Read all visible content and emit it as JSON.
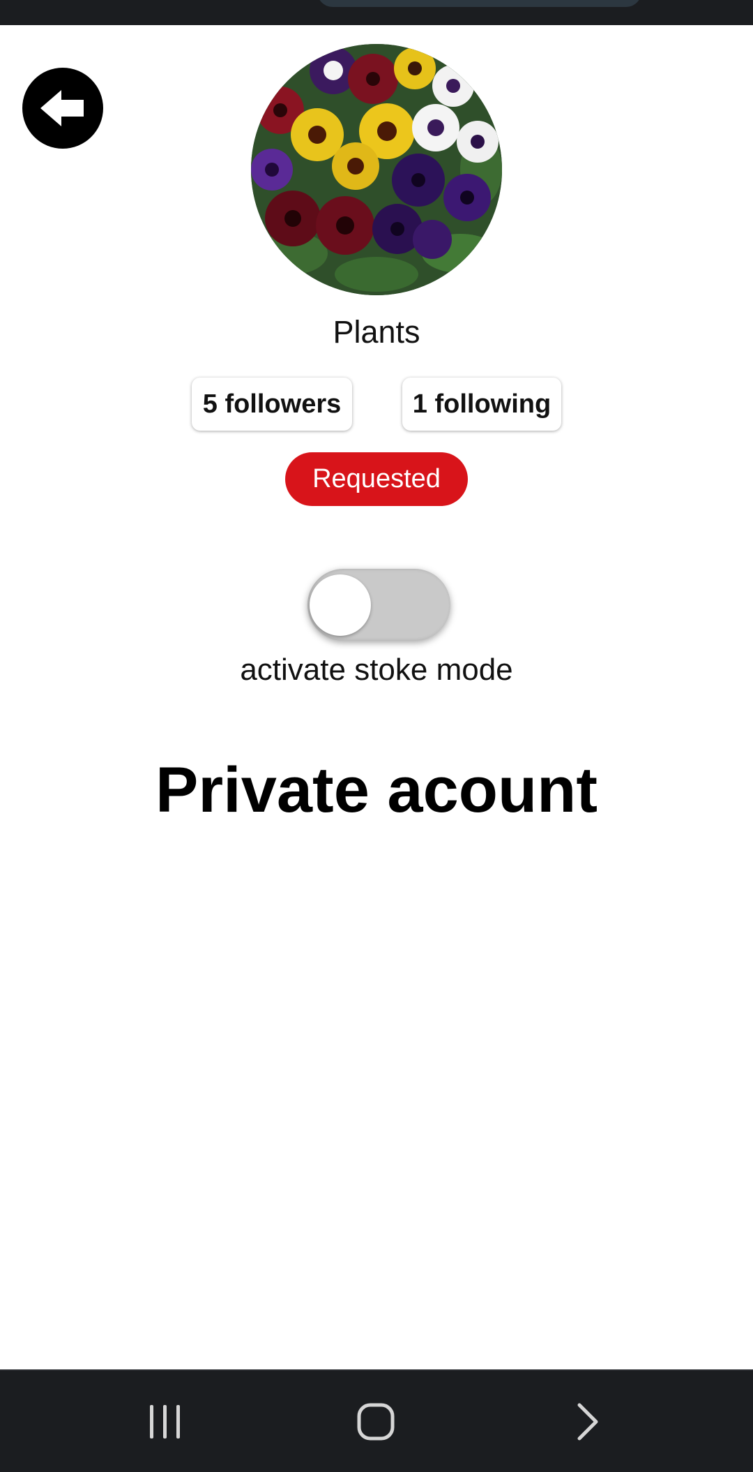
{
  "profile": {
    "name": "Plants",
    "followers_label": "5 followers",
    "following_label": "1 following",
    "request_status": "Requested",
    "avatar_icon": "pansy-flowers-photo"
  },
  "stoke_mode": {
    "label": "activate stoke mode",
    "enabled": false
  },
  "message": {
    "title": "Private acount"
  },
  "navigation": {
    "back_icon": "arrow-left-circle-icon",
    "system_buttons": [
      "recent-apps-icon",
      "home-icon",
      "forward-icon"
    ]
  },
  "colors": {
    "accent": "#d8141a",
    "system_bar": "#1b1d20"
  }
}
